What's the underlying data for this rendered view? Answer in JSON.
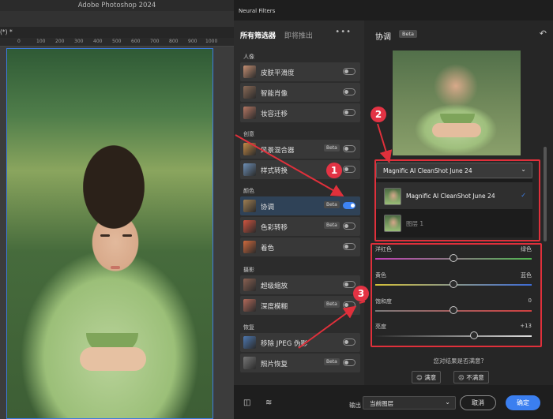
{
  "ps": {
    "title": "Adobe Photoshop 2024",
    "doc_tab": "(*) *",
    "ruler_ticks": [
      "0",
      "100",
      "200",
      "300",
      "400",
      "500",
      "600",
      "700",
      "800",
      "900",
      "1000"
    ]
  },
  "nf": {
    "window_title": "Neural Filters",
    "tabs": [
      "所有筛选器",
      "即将推出"
    ],
    "more_icon": "more-icon",
    "categories": {
      "portrait": "人像",
      "creative": "创意",
      "color": "颜色",
      "photography": "摄影",
      "restore": "恢复"
    },
    "filters": [
      {
        "label": "皮肤平滑度",
        "beta": "",
        "on": false,
        "color": "#c58f73"
      },
      {
        "label": "智能肖像",
        "beta": "",
        "on": false,
        "color": "#8a6a56"
      },
      {
        "label": "妆容迁移",
        "beta": "",
        "on": false,
        "color": "#b57763"
      },
      {
        "label": "风景混合器",
        "beta": "Beta",
        "on": false,
        "color": "#c48a45"
      },
      {
        "label": "样式转换",
        "beta": "",
        "on": false,
        "color": "#6e8fb5"
      },
      {
        "label": "协调",
        "beta": "Beta",
        "on": true,
        "color": "#9f7f52"
      },
      {
        "label": "色彩转移",
        "beta": "Beta",
        "on": false,
        "color": "#d0543f"
      },
      {
        "label": "着色",
        "beta": "",
        "on": false,
        "color": "#d06a3d"
      },
      {
        "label": "超级缩放",
        "beta": "",
        "on": false,
        "color": "#8a6152"
      },
      {
        "label": "深度模糊",
        "beta": "Beta",
        "on": false,
        "color": "#b26a5a"
      },
      {
        "label": "移除 JPEG 伪影",
        "beta": "",
        "on": false,
        "color": "#4d78b0"
      },
      {
        "label": "照片恢复",
        "beta": "Beta",
        "on": false,
        "color": "#777777"
      }
    ],
    "detail": {
      "title": "协调",
      "beta": "Beta",
      "reset_icon": "reset-icon",
      "dropdown_value": "Magnific AI CleanShot June 24",
      "options": [
        {
          "label": "Magnific AI CleanShot June 24",
          "selected": true
        },
        {
          "label": "图层 1",
          "selected": false
        }
      ],
      "sliders": [
        {
          "left": "洋红色",
          "right": "绿色",
          "value_fraction": 0.5,
          "colors": [
            "#c13fb5",
            "#4fb54f"
          ]
        },
        {
          "left": "黄色",
          "right": "蓝色",
          "value_fraction": 0.5,
          "colors": [
            "#d5c13a",
            "#3d6bd6"
          ]
        },
        {
          "left": "饱和度",
          "right": "0",
          "value_fraction": 0.5,
          "colors": [
            "#7a7a7a",
            "#d04040"
          ]
        },
        {
          "left": "亮度",
          "right": "+13",
          "value_fraction": 0.63,
          "colors": [
            "#2a2a2a",
            "#e0e0e0"
          ]
        }
      ],
      "feedback_question": "您对结果是否满意?",
      "satisfied": "满意",
      "unsatisfied": "不满意"
    },
    "bottom": {
      "output_label": "输出",
      "output_value": "当前图层",
      "cancel": "取消",
      "ok": "确定"
    }
  },
  "annotations": {
    "badges": [
      "1",
      "2",
      "3"
    ],
    "color": "#e0303b"
  }
}
